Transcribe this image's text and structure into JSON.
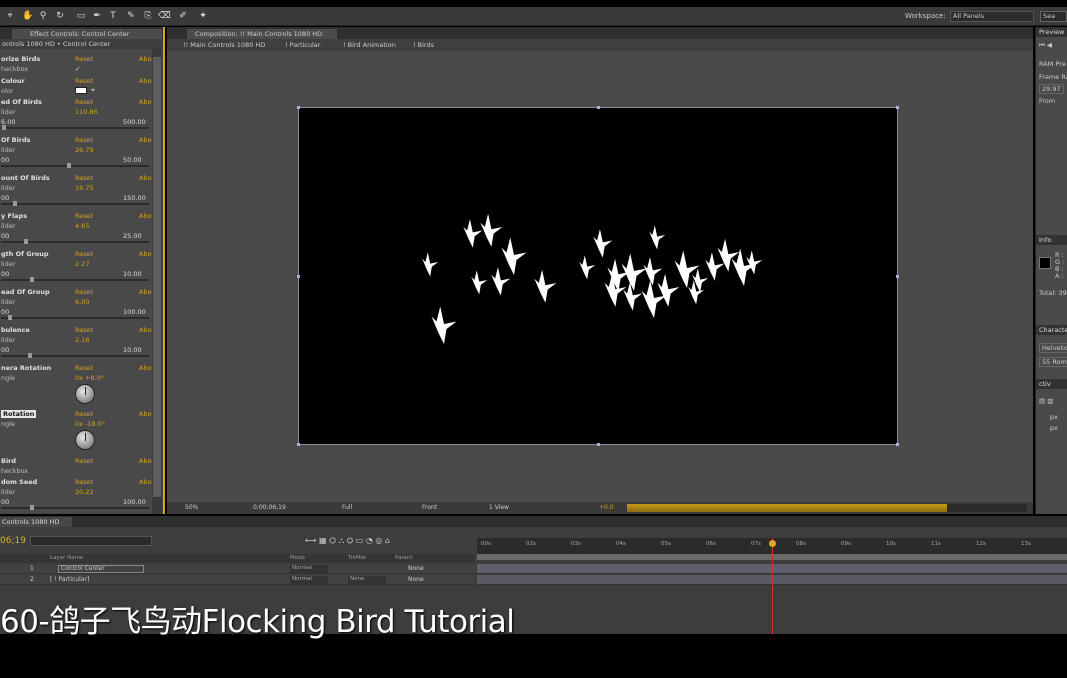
{
  "toolbar": {
    "workspace_label": "Workspace:",
    "workspace_value": "All Panels",
    "search_placeholder": "Sea"
  },
  "effects": {
    "tab_label": "Effect Controls: Control Center",
    "subheader": "ontrols 1080 HD • Control Center",
    "reset_label": "Reset",
    "about_label": "Abo",
    "properties": [
      {
        "name": "orize Birds",
        "sub": "heckbox",
        "value": "✓",
        "min": "",
        "max": "",
        "kind": "checkbox"
      },
      {
        "name": " Colour",
        "sub": "olor",
        "value": "",
        "min": "",
        "max": "",
        "kind": "color",
        "swatch": "#ffffff"
      },
      {
        "name": "ed Of Birds",
        "sub": "lider",
        "value": "110.86",
        "min": "6.00",
        "max": "500.00",
        "kind": "slider",
        "level": 0.01
      },
      {
        "name": " Of Birds",
        "sub": "lider",
        "value": "26.79",
        "min": "00",
        "max": "50.00",
        "kind": "slider",
        "level": 0.46
      },
      {
        "name": "ount Of Birds",
        "sub": "lider",
        "value": "16.75",
        "min": "00",
        "max": "150.00",
        "kind": "slider",
        "level": 0.08
      },
      {
        "name": "y Flaps",
        "sub": "lider",
        "value": "4.65",
        "min": "00",
        "max": "25.00",
        "kind": "slider",
        "level": 0.16
      },
      {
        "name": "gth Of Group",
        "sub": "lider",
        "value": "2.27",
        "min": "00",
        "max": "10.00",
        "kind": "slider",
        "level": 0.2
      },
      {
        "name": "ead Of Group",
        "sub": "lider",
        "value": "6.00",
        "min": "00",
        "max": "100.00",
        "kind": "slider",
        "level": 0.05
      },
      {
        "name": "bulence",
        "sub": "lider",
        "value": "2.16",
        "min": "00",
        "max": "10.00",
        "kind": "slider",
        "level": 0.19
      },
      {
        "name": "nera Rotation",
        "sub": "ngle",
        "value": "0x +8.0°",
        "min": "",
        "max": "",
        "kind": "dial"
      },
      {
        "name": " Rotation",
        "sub": "ngle",
        "value": "0x -18.0°",
        "min": "",
        "max": "",
        "kind": "dial",
        "selected": true
      },
      {
        "name": " Bird",
        "sub": "heckbox",
        "value": "",
        "min": "",
        "max": "",
        "kind": "checkbox"
      },
      {
        "name": "dom Seed",
        "sub": "lider",
        "value": "20.22",
        "min": "00",
        "max": "100.00",
        "kind": "slider",
        "level": 0.2
      }
    ]
  },
  "composition": {
    "tab_label": "Composition: !! Main Controls 1080 HD",
    "breadcrumbs": [
      "!! Main Controls 1080 HD",
      "! Particular",
      "! Bird Animation",
      "! Birds"
    ],
    "footer": {
      "zoom": "50%",
      "timecode": "0;00;06;19",
      "resolution": "Full",
      "view": "Front",
      "views": "1 View",
      "exposure": "+0.0"
    },
    "render_progress": 0.8
  },
  "right": {
    "preview_tab": "Preview",
    "ram_label": "RAM Pre",
    "frame_rate_label": "Frame Ra",
    "frame_rate_value": "29.97",
    "from_label": "From",
    "info_tab": "Info",
    "info_r": "R :",
    "info_g": "G :",
    "info_b": "B :",
    "info_a": "A :",
    "total_label": "Total: 39",
    "character_tab": "Characte",
    "font_name": "Helvetic",
    "font_style": "55 Roma",
    "paragraph_tab": "ctiv",
    "px1": "px",
    "px2": "px"
  },
  "timeline": {
    "tab_label": "Controls 1080 HD",
    "current_time": "06;19",
    "columns": {
      "layer_name": "Layer Name",
      "mode": "Mode",
      "trkmat": "TrkMat",
      "parent": "Parent"
    },
    "layers": [
      {
        "num": "1",
        "name": "Control Center",
        "mode": "Normal",
        "trkmat": "",
        "parent": "None"
      },
      {
        "num": "2",
        "name": "[ ! Particular]",
        "mode": "Normal",
        "trkmat": "None",
        "parent": "None"
      }
    ],
    "ruler_ticks": [
      "00s",
      "02s",
      "03s",
      "04s",
      "05s",
      "06s",
      "07s",
      "08s",
      "09s",
      "10s",
      "11s",
      "12s",
      "13s"
    ]
  },
  "caption": "60-鸽子飞鸟动Flocking Bird Tutorial",
  "colors": {
    "accent": "#d5a020",
    "panel": "#4a4a4a",
    "viewer_bg": "#000000"
  }
}
